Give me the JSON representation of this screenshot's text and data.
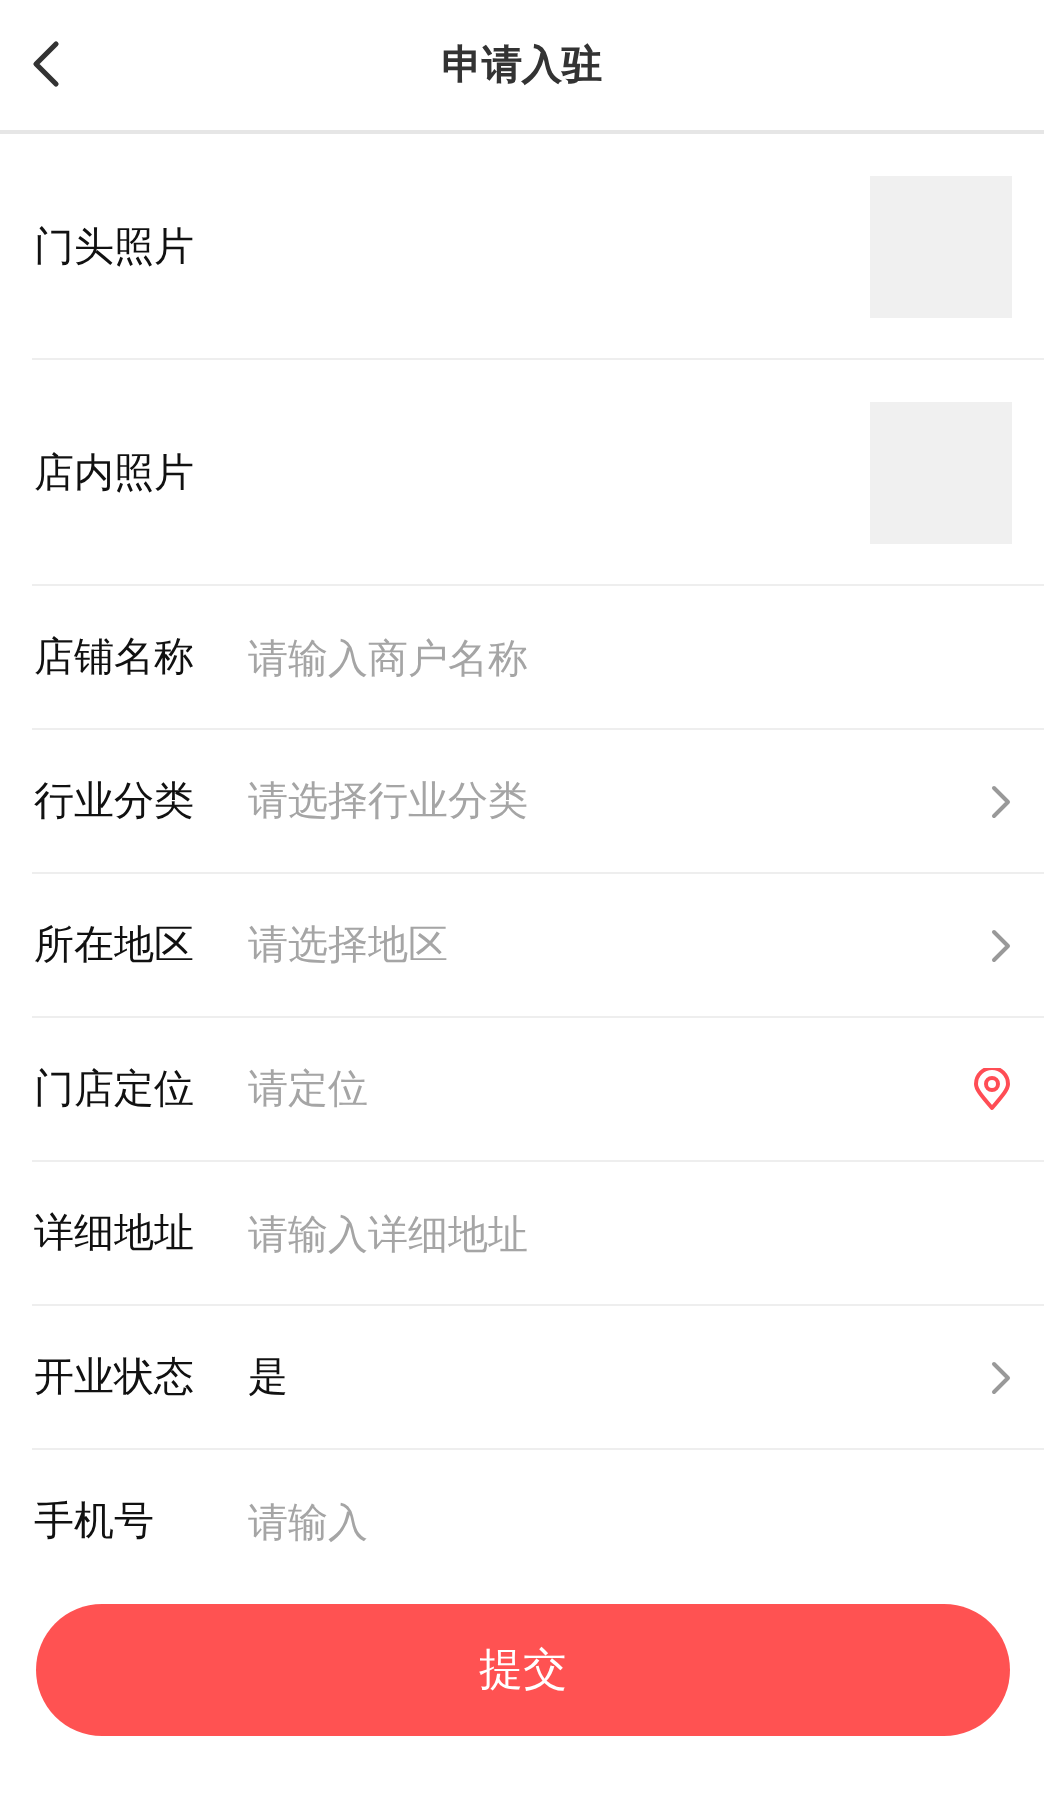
{
  "header": {
    "title": "申请入驻"
  },
  "photos": [
    {
      "label": "门头照片"
    },
    {
      "label": "店内照片"
    }
  ],
  "fields": [
    {
      "label": "店铺名称",
      "kind": "text",
      "placeholder": "请输入商户名称"
    },
    {
      "label": "行业分类",
      "kind": "select",
      "placeholder": "请选择行业分类"
    },
    {
      "label": "所在地区",
      "kind": "select",
      "placeholder": "请选择地区"
    },
    {
      "label": "门店定位",
      "kind": "location",
      "placeholder": "请定位"
    },
    {
      "label": "详细地址",
      "kind": "text",
      "placeholder": "请输入详细地址"
    },
    {
      "label": "开业状态",
      "kind": "select",
      "value": "是"
    },
    {
      "label": "手机号",
      "kind": "text",
      "placeholder": "请输入"
    }
  ],
  "submit": {
    "label": "提交"
  }
}
